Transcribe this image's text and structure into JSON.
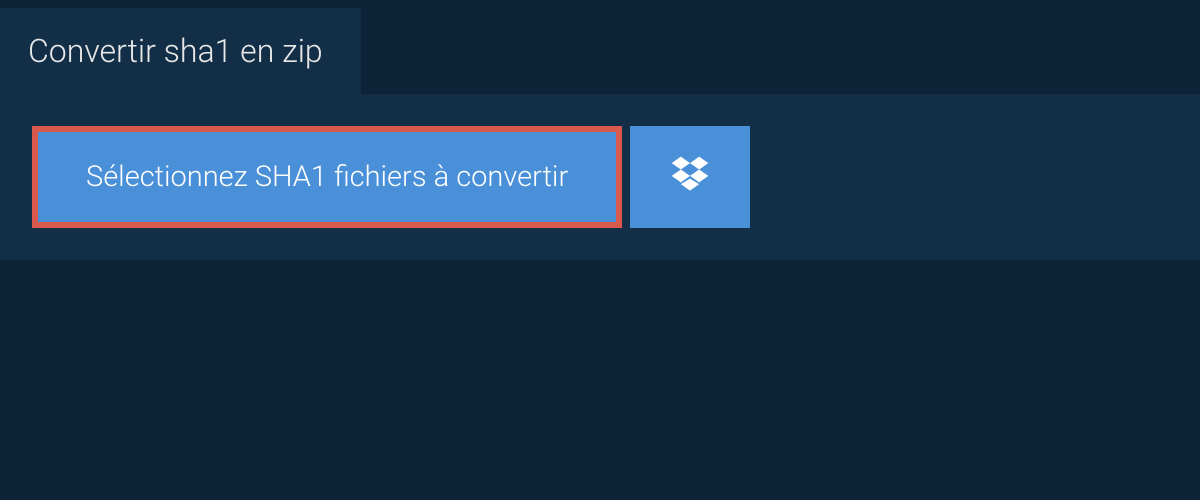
{
  "tab": {
    "title": "Convertir sha1 en zip"
  },
  "actions": {
    "select_files_label": "Sélectionnez SHA1 fichiers à convertir"
  },
  "colors": {
    "background": "#0d2438",
    "panel": "#132f47",
    "button": "#4a90d9",
    "highlight_border": "#d9594c",
    "text_light": "#e8e8e8",
    "text_white": "#ffffff"
  }
}
